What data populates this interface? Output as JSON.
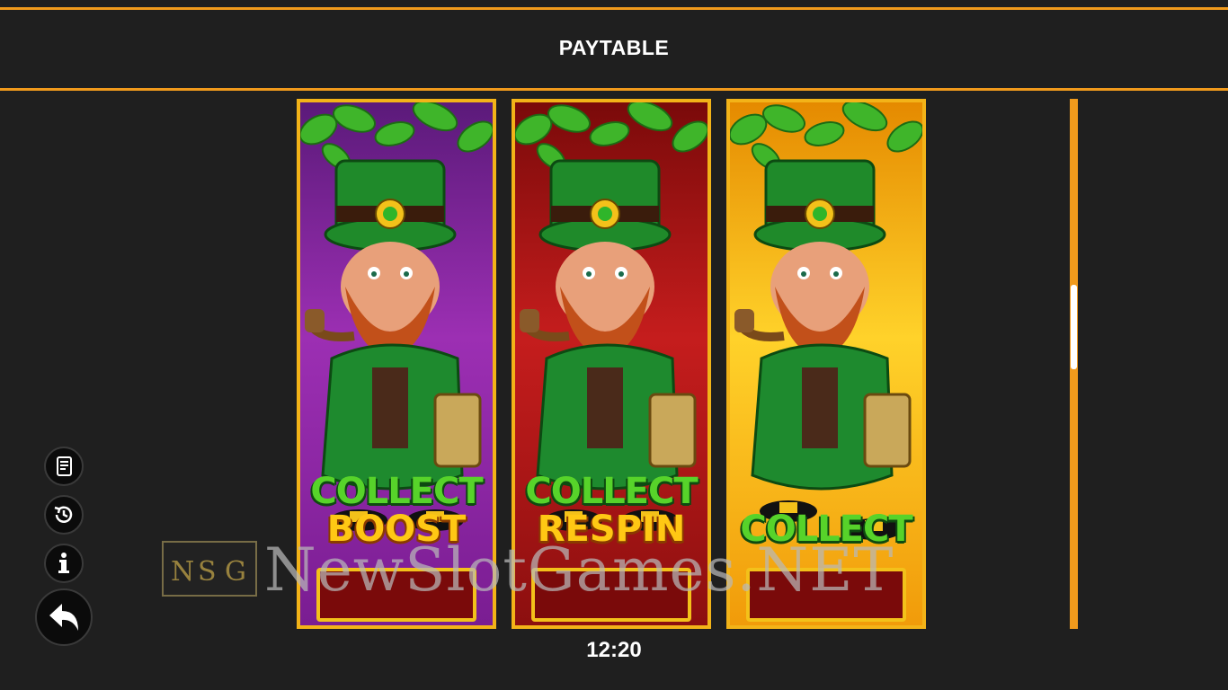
{
  "header": {
    "title": "PAYTABLE"
  },
  "footer": {
    "clock": "12:20"
  },
  "reels": [
    {
      "theme": "purple",
      "line1": "COLLECT",
      "line2": "BOOST"
    },
    {
      "theme": "red",
      "line1": "COLLECT",
      "line2": "RESPIN"
    },
    {
      "theme": "yellow",
      "line1": "COLLECT",
      "line2": ""
    }
  ],
  "side_buttons": [
    {
      "name": "paytable-button",
      "icon": "scroll-icon"
    },
    {
      "name": "history-button",
      "icon": "history-icon"
    },
    {
      "name": "info-button",
      "icon": "info-icon"
    },
    {
      "name": "back-button",
      "icon": "back-arrow-icon"
    }
  ],
  "watermark": {
    "logo_letters": [
      "N",
      "S",
      "G"
    ],
    "text": "NewSlotGames.NET"
  },
  "colors": {
    "accent": "#f09a1c",
    "background": "#1f1f1f",
    "frame_gold": "#f3b318"
  }
}
